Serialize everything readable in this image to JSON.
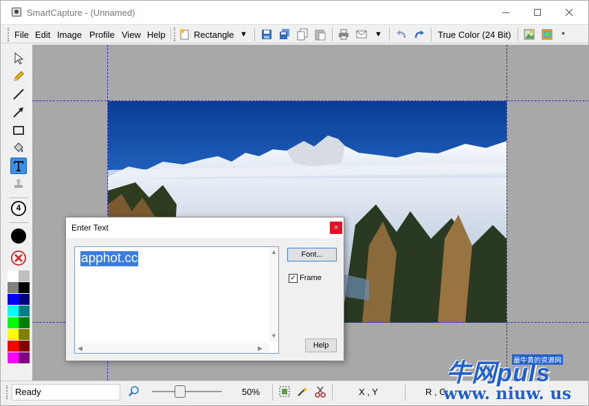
{
  "window": {
    "title": "SmartCapture - (Unnamed)"
  },
  "menu": [
    "File",
    "Edit",
    "Image",
    "Profile",
    "View",
    "Help"
  ],
  "toolbar": {
    "capture_mode": "Rectangle",
    "dropdown_glyph": "▼",
    "color_depth": "True Color (24 Bit)",
    "extra": "*"
  },
  "tools": [
    {
      "name": "select-arrow-icon"
    },
    {
      "name": "pencil-icon"
    },
    {
      "name": "line-icon"
    },
    {
      "name": "arrow-icon"
    },
    {
      "name": "rectangle-icon"
    },
    {
      "name": "fill-bucket-icon"
    },
    {
      "name": "text-tool-icon",
      "active": true
    },
    {
      "name": "stamp-icon"
    }
  ],
  "number_tool": {
    "label": "4"
  },
  "palette": [
    [
      "#ffffff",
      "#c0c0c0"
    ],
    [
      "#808080",
      "#000000"
    ],
    [
      "#0000ff",
      "#000080"
    ],
    [
      "#00ffff",
      "#008080"
    ],
    [
      "#00ff00",
      "#008000"
    ],
    [
      "#ffff00",
      "#808000"
    ],
    [
      "#ff0000",
      "#800000"
    ],
    [
      "#ff00ff",
      "#800080"
    ]
  ],
  "dialog": {
    "title": "Enter Text",
    "close_glyph": "×",
    "text_value": "apphot.cc",
    "font_button": "Font...",
    "frame_label": "Frame",
    "frame_checked": true,
    "check_glyph": "✓",
    "help_button": "Help"
  },
  "status": {
    "ready": "Ready",
    "zoom": "50%",
    "zoom_level": 0.5,
    "coords": "X , Y",
    "color_readout": "R , G"
  },
  "watermark": {
    "cn": "牛网puls",
    "sub": "最牛黄的资源网",
    "url": "www. niuw. us"
  },
  "colors": {
    "accent": "#3b7ddf",
    "guide": "#2a2acc",
    "canvas_bg": "#a8a8a8",
    "close_red": "#e81123"
  }
}
